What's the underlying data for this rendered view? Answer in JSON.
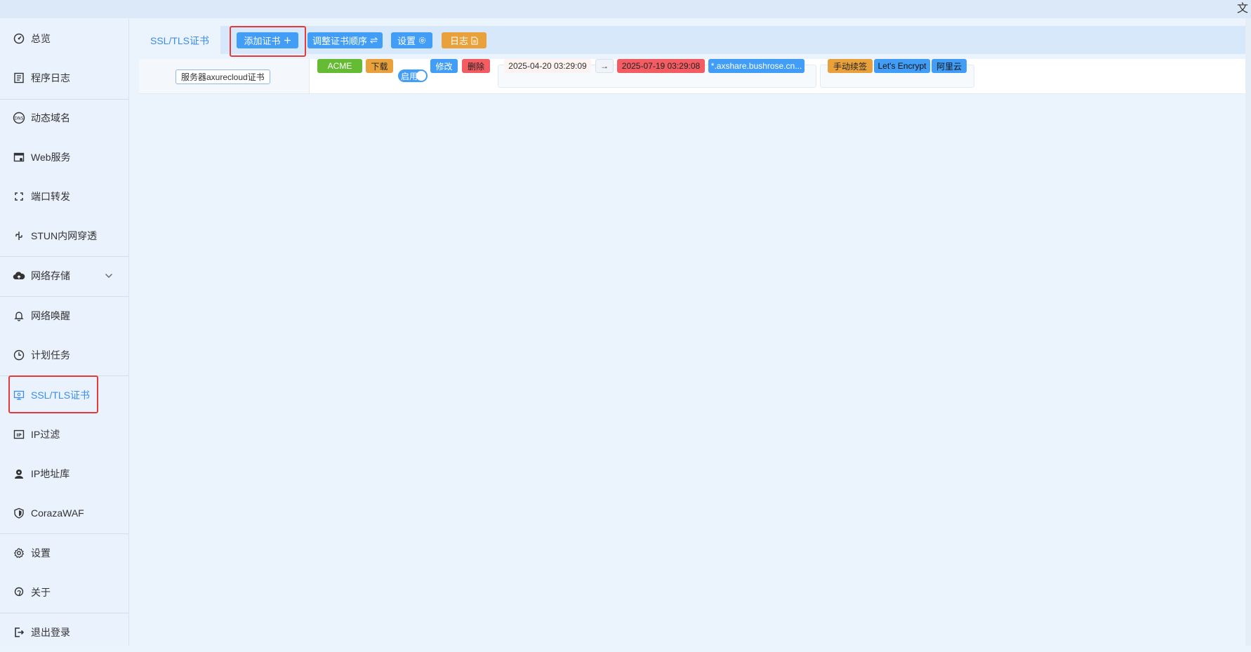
{
  "corner_glyph": "文",
  "sidebar": {
    "items": [
      {
        "label": "总览",
        "icon": "dashboard-icon"
      },
      {
        "label": "程序日志",
        "icon": "log-list-icon"
      },
      {
        "label": "动态域名",
        "icon": "dns-icon"
      },
      {
        "label": "Web服务",
        "icon": "browser-window-icon"
      },
      {
        "label": "端口转发",
        "icon": "port-forward-icon"
      },
      {
        "label": "STUN内网穿透",
        "icon": "stun-tunnel-icon"
      },
      {
        "label": "网络存储",
        "icon": "cloud-icon"
      },
      {
        "label": "网络唤醒",
        "icon": "bell-icon"
      },
      {
        "label": "计划任务",
        "icon": "clock-icon"
      },
      {
        "label": "SSL/TLS证书",
        "icon": "certificate-icon"
      },
      {
        "label": "IP过滤",
        "icon": "ip-filter-icon"
      },
      {
        "label": "IP地址库",
        "icon": "user-location-icon"
      },
      {
        "label": "CorazaWAF",
        "icon": "shield-icon"
      },
      {
        "label": "设置",
        "icon": "gear-icon"
      },
      {
        "label": "关于",
        "icon": "info-hand-icon"
      },
      {
        "label": "退出登录",
        "icon": "logout-icon"
      }
    ],
    "active": "SSL/TLS证书"
  },
  "tabs": {
    "active_label": "SSL/TLS证书"
  },
  "toolbar": {
    "add_cert": "添加证书",
    "reorder": "调整证书顺序",
    "settings": "设置",
    "log": "日志"
  },
  "cert_row": {
    "name": "服务器axurecloud证书",
    "type": "ACME",
    "download": "下载",
    "enable_label": "启用",
    "enabled": true,
    "edit": "修改",
    "delete": "删除",
    "valid_from": "2025-04-20 03:29:09",
    "arrow": "→",
    "valid_to": "2025-07-19 03:29:08",
    "domain": "*.axshare.bushrose.cn...",
    "renew_mode": "手动续签",
    "issuer": "Let's Encrypt",
    "dns_provider": "阿里云"
  },
  "colors": {
    "accent_blue": "#419df5",
    "orange": "#e9a23b",
    "green": "#66bb34",
    "red": "#f25c62",
    "highlight": "#e53a3a"
  }
}
